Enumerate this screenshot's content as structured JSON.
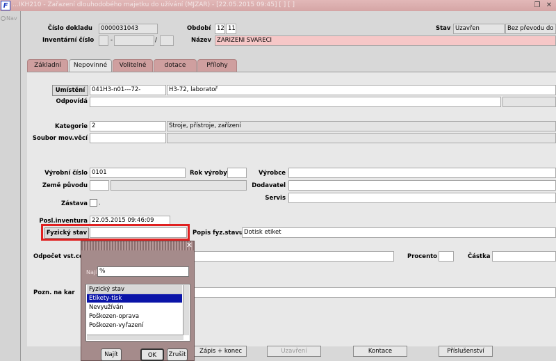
{
  "titlebar": {
    "title": "…IKH210 - Zařazení dlouhodobého majetku do užívání (MJZAR) - [22.05.2015 09:45] [ ] [ ]",
    "restore_icon": "restore-icon",
    "close_icon": "close-icon"
  },
  "nav": {
    "label": "Nav"
  },
  "header": {
    "cislo_dokladu_label": "Číslo dokladu",
    "cislo_dokladu_value": "0000031043",
    "obdobi_label": "Období",
    "obdobi_value1": "12",
    "obdobi_value2": "11",
    "stav_label": "Stav",
    "stav_value": "Uzavřen",
    "stav_value2": "Bez převodu do ú",
    "inventarni_cislo_label": "Inventární číslo",
    "inventarni_sep1": "-",
    "inventarni_sep2": "/",
    "nazev_label": "Název",
    "nazev_value": "ZARIZENI SVARECI"
  },
  "tabs": [
    {
      "label": "Základní"
    },
    {
      "label": "Nepovinné"
    },
    {
      "label": "Volitelné"
    },
    {
      "label": "dotace"
    },
    {
      "label": "Přílohy"
    }
  ],
  "form": {
    "umisteni_label": "Umístění",
    "umisteni_code": "041H3-n01---72-",
    "umisteni_desc": "H3-72, laboratoř",
    "odpovida_label": "Odpovídá",
    "kategorie_label": "Kategorie",
    "kategorie_code": "2",
    "kategorie_desc": "Stroje, přístroje, zařízení",
    "soubor_label": "Soubor mov.věcí",
    "vyrobni_cislo_label": "Výrobní číslo",
    "vyrobni_cislo_value": "0101",
    "rok_vyroby_label": "Rok výroby",
    "vyrobce_label": "Výrobce",
    "zeme_puvodu_label": "Země původu",
    "dodavatel_label": "Dodavatel",
    "servis_label": "Servis",
    "zastava_label": "Zástava",
    "zastava_suffix": ".",
    "posl_inventura_label": "Posl.inventura",
    "posl_inventura_value": "22.05.2015 09:46:09",
    "fyzicky_stav_label": "Fyzický stav",
    "popis_fyz_label": "Popis fyz.stavu",
    "popis_fyz_value": "Dotisk etiket",
    "odpocet_label": "Odpočet vst.ce",
    "procento_label": "Procento",
    "castka_label": "Částka",
    "pozn_label": "Pozn. na kar"
  },
  "bottom_buttons": {
    "zapis_label": "Zápis + konec",
    "uzavreni_label": "Uzavření",
    "kontace_label": "Kontace",
    "prislusenstvi_label": "Příslušenství"
  },
  "lov_dialog": {
    "close_icon": "close-icon",
    "najit_label": "Najít",
    "search_value": "%",
    "header": "Fyzický stav",
    "items": [
      {
        "label": "Etikety-tisk",
        "selected": true
      },
      {
        "label": "Nevyužíván",
        "selected": false
      },
      {
        "label": "Poškozen-oprava",
        "selected": false
      },
      {
        "label": "Poškozen-vyřazení",
        "selected": false
      }
    ],
    "najit_button": "Najít",
    "ok_button": "OK",
    "zrusit_button": "Zrušit"
  },
  "colors": {
    "titlebar": "#d5a5a5",
    "tab": "#cf9f9f",
    "highlight_box": "#e02020",
    "list_selection": "#0a14a8",
    "required_field": "#f6c7c7"
  }
}
